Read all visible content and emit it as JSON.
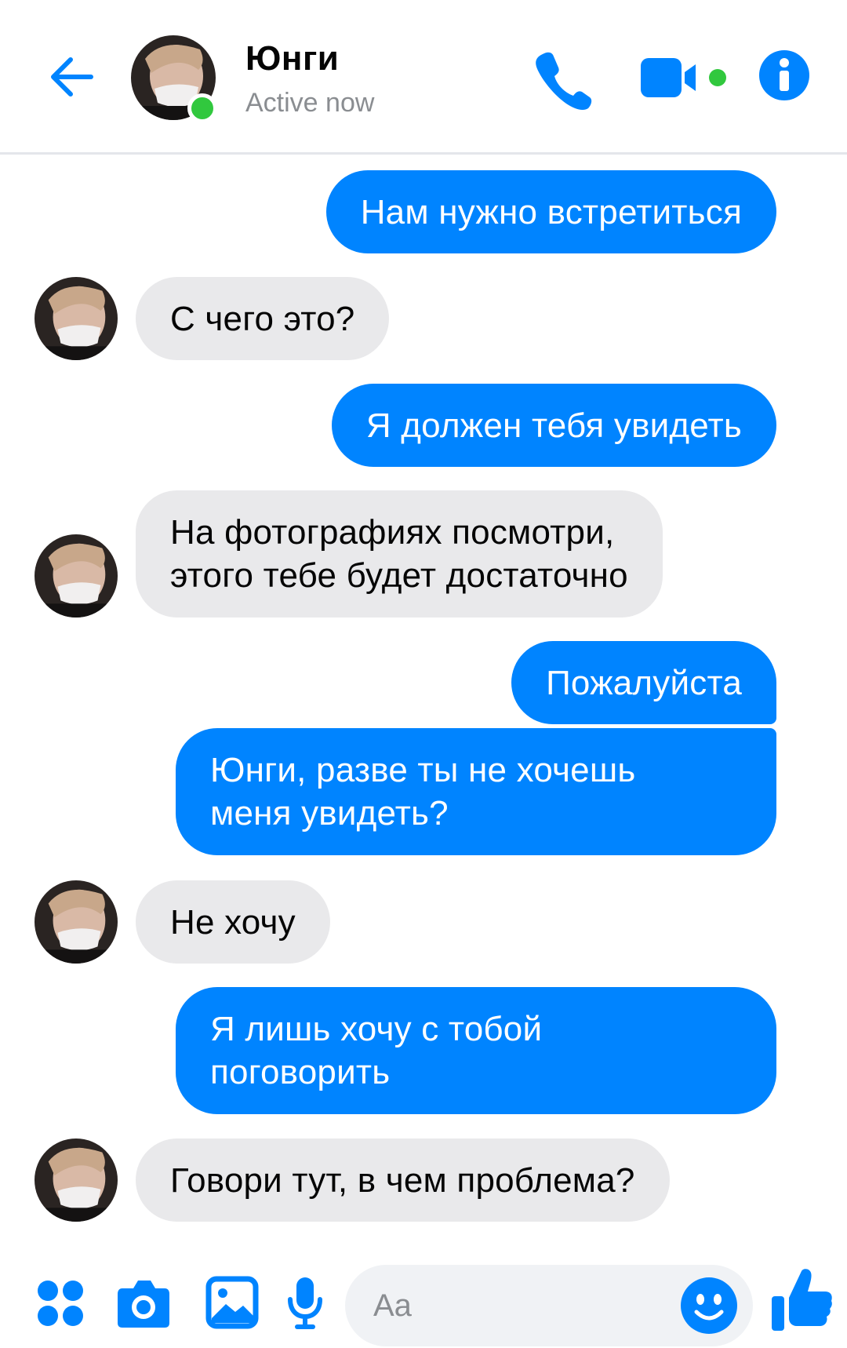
{
  "header": {
    "contact_name": "Юнги",
    "status": "Active now",
    "icons": {
      "back": "arrow-left-icon",
      "call": "phone-icon",
      "video": "video-camera-icon",
      "info": "info-icon"
    },
    "accent_color": "#0084ff",
    "online_color": "#31c83e"
  },
  "messages": [
    {
      "direction": "outgoing",
      "lines": [
        "Нам нужно встретиться"
      ]
    },
    {
      "direction": "incoming",
      "lines": [
        "С чего это?"
      ]
    },
    {
      "direction": "outgoing",
      "lines": [
        "Я должен тебя увидеть"
      ]
    },
    {
      "direction": "incoming",
      "lines": [
        "На фотографиях посмотри,",
        "этого тебе будет достаточно"
      ]
    },
    {
      "direction": "outgoing",
      "lines": [
        "Пожалуйста"
      ]
    },
    {
      "direction": "outgoing",
      "lines": [
        "Юнги, разве ты не хочешь",
        "меня увидеть?"
      ]
    },
    {
      "direction": "incoming",
      "lines": [
        "Не хочу"
      ]
    },
    {
      "direction": "outgoing",
      "lines": [
        "Я лишь хочу с тобой",
        "поговорить"
      ]
    },
    {
      "direction": "incoming",
      "lines": [
        "Говори тут, в чем проблема?"
      ]
    }
  ],
  "composer": {
    "placeholder": "Aa",
    "icons": {
      "menu": "four-dots-menu-icon",
      "camera": "camera-icon",
      "gallery": "image-icon",
      "voice": "microphone-icon",
      "emoji": "smiley-icon",
      "like": "thumbs-up-icon"
    }
  },
  "colors": {
    "outgoing_bubble": "#0084ff",
    "incoming_bubble": "#e9e9eb"
  }
}
